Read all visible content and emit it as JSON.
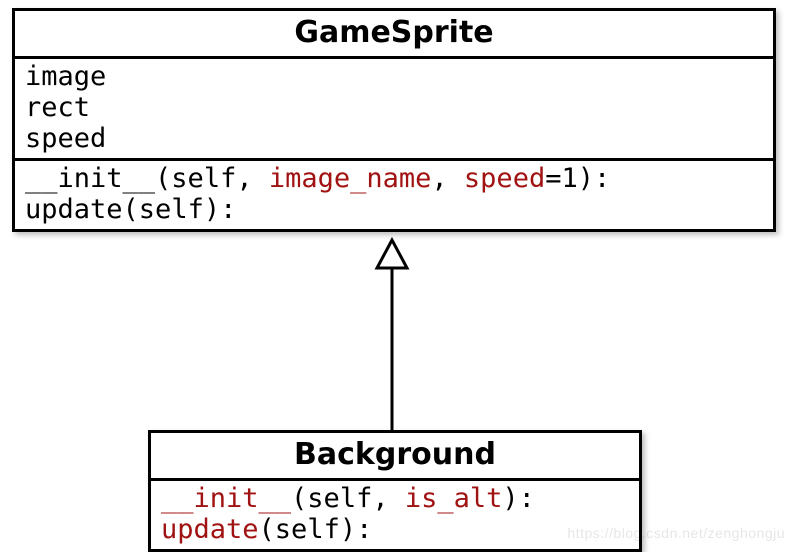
{
  "parent": {
    "name": "GameSprite",
    "attributes": [
      "image",
      "rect",
      "speed"
    ],
    "methods": [
      {
        "prefix": "__init__",
        "mid1": "(self, ",
        "p1": "image_name",
        "mid2": ", ",
        "p2": "speed",
        "suffix": "=1):",
        "prefix_red": false,
        "p1_red": true,
        "p2_red": true
      },
      {
        "prefix": "update",
        "mid1": "(self):",
        "p1": "",
        "mid2": "",
        "p2": "",
        "suffix": "",
        "prefix_red": false,
        "p1_red": false,
        "p2_red": false
      }
    ]
  },
  "child": {
    "name": "Background",
    "methods": [
      {
        "prefix": "__init__",
        "mid1": "(self, ",
        "p1": "is_alt",
        "mid2": "",
        "p2": "",
        "suffix": "):",
        "prefix_red": true,
        "p1_red": true,
        "p2_red": false
      },
      {
        "prefix": "update",
        "mid1": "(self):",
        "p1": "",
        "mid2": "",
        "p2": "",
        "suffix": "",
        "prefix_red": true,
        "p1_red": false,
        "p2_red": false
      }
    ]
  },
  "watermark": "https://blog.csdn.net/zenghongju"
}
